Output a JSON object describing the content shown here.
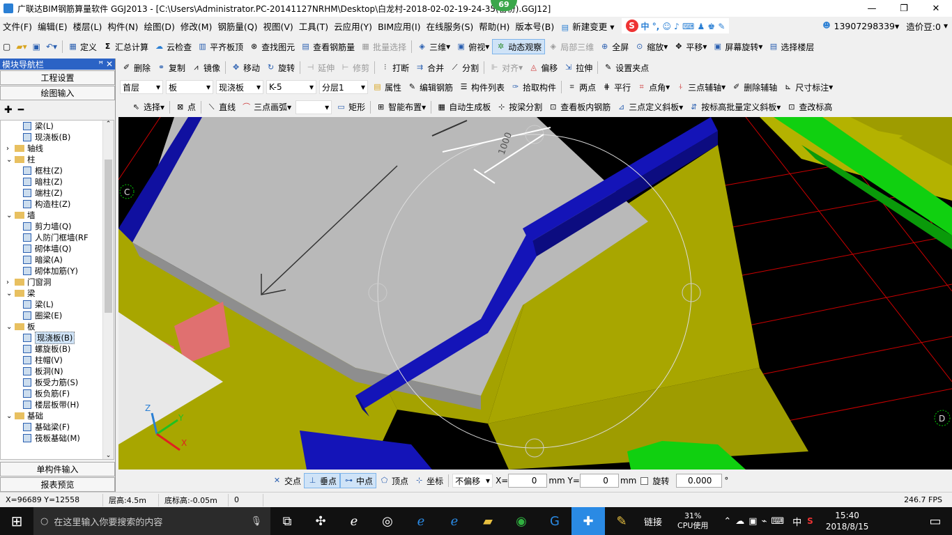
{
  "window": {
    "title": "广联达BIM钢筋算量软件 GGJ2013 - [C:\\Users\\Administrator.PC-20141127NRHM\\Desktop\\白龙村-2018-02-02-19-24-35(备份).GGJ12]",
    "badge": "69",
    "min": "—",
    "max": "❐",
    "close": "✕"
  },
  "menu": [
    "文件(F)",
    "编辑(E)",
    "楼层(L)",
    "构件(N)",
    "绘图(D)",
    "修改(M)",
    "钢筋量(Q)",
    "视图(V)",
    "工具(T)",
    "云应用(Y)",
    "BIM应用(I)",
    "在线服务(S)",
    "帮助(H)",
    "版本号(B)",
    "新建变更"
  ],
  "menu_right": {
    "phone": "13907298339",
    "price": "造价豆:0"
  },
  "toolbar1": [
    "定义",
    "汇总计算",
    "云检查",
    "平齐板顶",
    "查找图元",
    "查看钢筋量",
    "批量选择",
    "三维",
    "俯视",
    "动态观察",
    "局部三维",
    "全屏",
    "缩放",
    "平移",
    "屏幕旋转",
    "选择楼层"
  ],
  "toolbar2": [
    "删除",
    "复制",
    "镜像",
    "移动",
    "旋转",
    "延伸",
    "修剪",
    "打断",
    "合并",
    "分割",
    "对齐",
    "偏移",
    "拉伸",
    "设置夹点"
  ],
  "toolbar3": {
    "floor": "首层",
    "type": "板",
    "sub": "现浇板",
    "name": "K-5",
    "layer": "分层1",
    "items": [
      "属性",
      "编辑钢筋",
      "构件列表",
      "拾取构件",
      "两点",
      "平行",
      "点角",
      "三点辅轴",
      "删除辅轴",
      "尺寸标注"
    ]
  },
  "toolbar4": [
    "选择",
    "点",
    "直线",
    "三点画弧",
    "矩形",
    "智能布置",
    "自动生成板",
    "按梁分割",
    "查看板内钢筋",
    "三点定义斜板",
    "按标高批量定义斜板",
    "查改标高"
  ],
  "leftpanel": {
    "title": "模块导航栏",
    "pin": "ꟸ ✕",
    "btn1": "工程设置",
    "btn2": "绘图输入",
    "btn3": "单构件输入",
    "btn4": "报表预览",
    "tree": [
      {
        "indent": 3,
        "label": "梁(L)",
        "kind": "item"
      },
      {
        "indent": 3,
        "label": "现浇板(B)",
        "kind": "item"
      },
      {
        "indent": 1,
        "label": "轴线",
        "kind": "folder",
        "exp": "›"
      },
      {
        "indent": 1,
        "label": "柱",
        "kind": "folder",
        "exp": "⌄"
      },
      {
        "indent": 3,
        "label": "框柱(Z)",
        "kind": "item"
      },
      {
        "indent": 3,
        "label": "暗柱(Z)",
        "kind": "item"
      },
      {
        "indent": 3,
        "label": "端柱(Z)",
        "kind": "item"
      },
      {
        "indent": 3,
        "label": "构造柱(Z)",
        "kind": "item"
      },
      {
        "indent": 1,
        "label": "墙",
        "kind": "folder",
        "exp": "⌄"
      },
      {
        "indent": 3,
        "label": "剪力墙(Q)",
        "kind": "item"
      },
      {
        "indent": 3,
        "label": "人防门框墙(RF",
        "kind": "item"
      },
      {
        "indent": 3,
        "label": "砌体墙(Q)",
        "kind": "item"
      },
      {
        "indent": 3,
        "label": "暗梁(A)",
        "kind": "item"
      },
      {
        "indent": 3,
        "label": "砌体加筋(Y)",
        "kind": "item"
      },
      {
        "indent": 1,
        "label": "门窗洞",
        "kind": "folder",
        "exp": "›"
      },
      {
        "indent": 1,
        "label": "梁",
        "kind": "folder",
        "exp": "⌄"
      },
      {
        "indent": 3,
        "label": "梁(L)",
        "kind": "item"
      },
      {
        "indent": 3,
        "label": "圈梁(E)",
        "kind": "item"
      },
      {
        "indent": 1,
        "label": "板",
        "kind": "folder",
        "exp": "⌄"
      },
      {
        "indent": 3,
        "label": "现浇板(B)",
        "kind": "item",
        "selected": true
      },
      {
        "indent": 3,
        "label": "螺旋板(B)",
        "kind": "item"
      },
      {
        "indent": 3,
        "label": "柱帽(V)",
        "kind": "item"
      },
      {
        "indent": 3,
        "label": "板洞(N)",
        "kind": "item"
      },
      {
        "indent": 3,
        "label": "板受力筋(S)",
        "kind": "item"
      },
      {
        "indent": 3,
        "label": "板负筋(F)",
        "kind": "item"
      },
      {
        "indent": 3,
        "label": "楼层板带(H)",
        "kind": "item"
      },
      {
        "indent": 1,
        "label": "基础",
        "kind": "folder",
        "exp": "⌄"
      },
      {
        "indent": 3,
        "label": "基础梁(F)",
        "kind": "item"
      },
      {
        "indent": 3,
        "label": "筏板基础(M)",
        "kind": "item"
      }
    ]
  },
  "canvas": {
    "axis_c": "C",
    "axis_d": "D",
    "dim": "1000",
    "xyz": [
      "Z",
      "Y",
      "X"
    ]
  },
  "snapbar": {
    "items": [
      "交点",
      "垂点",
      "中点",
      "顶点",
      "坐标"
    ],
    "offset": "不偏移",
    "x_label": "X=",
    "x_val": "0",
    "y_label": "mm Y=",
    "y_val": "0",
    "mm": "mm",
    "rotate": "旋转",
    "rot_val": "0.000",
    "deg": "°"
  },
  "status": {
    "coords": "X=96689 Y=12558",
    "floor_h": "层高:4.5m",
    "base_h": "底标高:-0.05m",
    "zero": "0",
    "fps": "246.7 FPS"
  },
  "taskbar": {
    "search": "在这里输入你要搜索的内容",
    "link": "链接",
    "cpu_pct": "31%",
    "cpu_label": "CPU使用",
    "ime": "中",
    "time": "15:40",
    "date": "2018/8/15"
  }
}
